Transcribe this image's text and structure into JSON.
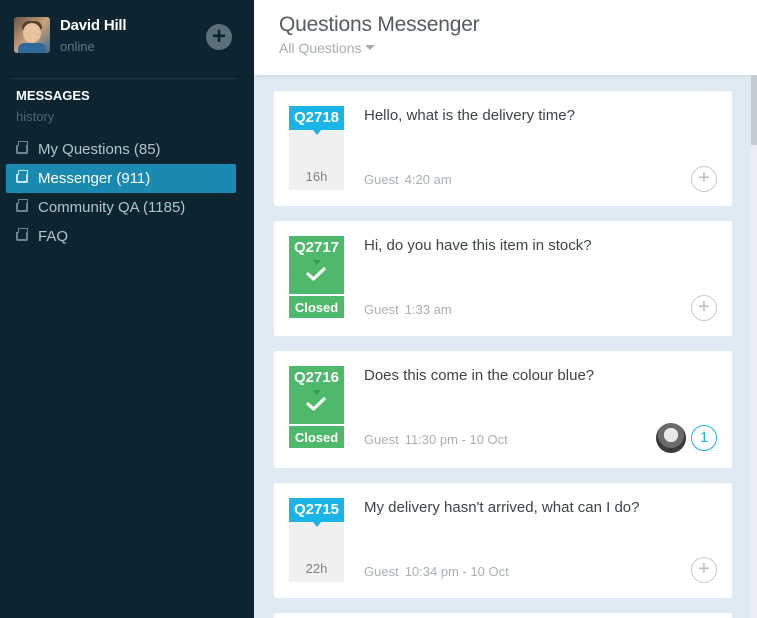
{
  "user": {
    "name": "David Hill",
    "status": "online"
  },
  "sidebar": {
    "section_title": "MESSAGES",
    "section_sub": "history",
    "items": [
      {
        "label": "My Questions (85)",
        "icon": "inbox-icon",
        "active": false
      },
      {
        "label": "Messenger (911)",
        "icon": "inbox-icon",
        "active": true
      },
      {
        "label": "Community QA (1185)",
        "icon": "inbox-icon",
        "active": false
      },
      {
        "label": "FAQ",
        "icon": "inbox-icon",
        "active": false
      }
    ]
  },
  "header": {
    "title": "Questions Messenger",
    "filter": "All Questions"
  },
  "questions": [
    {
      "id": "Q2718",
      "text": "Hello, what is the delivery time?",
      "age": "16h",
      "status": "open",
      "author": "Guest",
      "time": "4:20 am",
      "replies": null
    },
    {
      "id": "Q2717",
      "text": "Hi, do you have this item in stock?",
      "age": "",
      "status": "Closed",
      "author": "Guest",
      "time": "1:33 am",
      "replies": null
    },
    {
      "id": "Q2716",
      "text": "Does this come in the colour blue?",
      "age": "",
      "status": "Closed",
      "author": "Guest",
      "time": "11:30 pm - 10 Oct",
      "replies": "1"
    },
    {
      "id": "Q2715",
      "text": "My delivery hasn't arrived, what can I do?",
      "age": "22h",
      "status": "open",
      "author": "Guest",
      "time": "10:34 pm - 10 Oct",
      "replies": null
    }
  ],
  "colors": {
    "sidebar_bg": "#0c2530",
    "active": "#1b8ab1",
    "tag_blue": "#1ab4e8",
    "tag_green": "#4eb96a"
  }
}
